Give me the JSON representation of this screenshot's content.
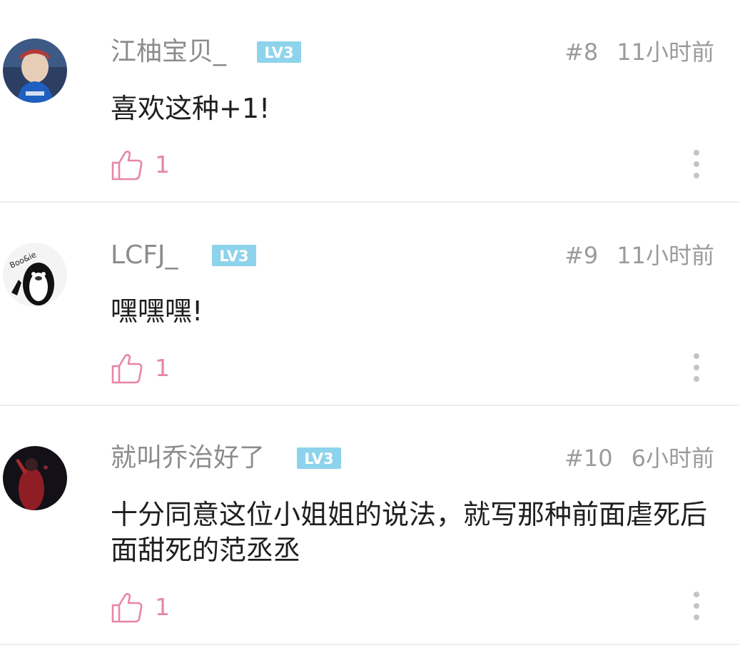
{
  "comments": [
    {
      "username": "江柚宝贝_",
      "level": "LV3",
      "floor": "#8",
      "time": "11小时前",
      "text": "喜欢这种+1!",
      "likes": "1"
    },
    {
      "username": "LCFJ_",
      "level": "LV3",
      "floor": "#9",
      "time": "11小时前",
      "text": "嘿嘿嘿!",
      "likes": "1"
    },
    {
      "username": "就叫乔治好了",
      "level": "LV3",
      "floor": "#10",
      "time": "6小时前",
      "text": "十分同意这位小姐姐的说法，就写那种前面虐死后面甜死的范丞丞",
      "likes": "1"
    }
  ],
  "colors": {
    "badge": "#8ed3ec",
    "like": "#e886a5",
    "meta": "#9b9b9b",
    "username": "#8c8c8c"
  },
  "icons": {
    "like": "thumbs-up-icon",
    "more": "more-vertical-icon"
  }
}
